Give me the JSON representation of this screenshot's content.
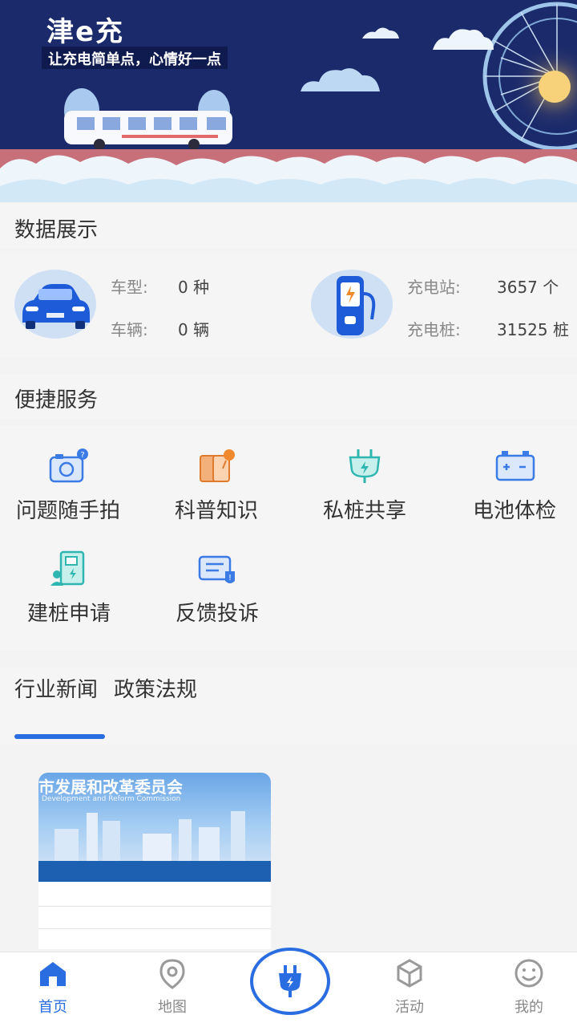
{
  "banner": {
    "brand": "津e充",
    "slogan": "让充电简单点，心情好一点"
  },
  "data_section": {
    "title": "数据展示",
    "vehicle": {
      "icon": "car-icon",
      "model_label": "车型:",
      "model_value": "0 种",
      "vehicle_label": "车辆:",
      "vehicle_value": "0 辆"
    },
    "charging": {
      "icon": "charging-pile-icon",
      "station_label": "充电站:",
      "station_value": "3657 个",
      "pile_label": "充电桩:",
      "pile_value": "31525 桩"
    }
  },
  "services_section": {
    "title": "便捷服务",
    "items": [
      {
        "label": "问题随手拍",
        "icon": "camera-icon"
      },
      {
        "label": "科普知识",
        "icon": "book-icon"
      },
      {
        "label": "私桩共享",
        "icon": "plug-share-icon"
      },
      {
        "label": "电池体检",
        "icon": "battery-icon"
      },
      {
        "label": "建桩申请",
        "icon": "pile-apply-icon"
      },
      {
        "label": "反馈投诉",
        "icon": "feedback-icon"
      }
    ]
  },
  "news_section": {
    "tabs": [
      {
        "label": "行业新闻",
        "active": true
      },
      {
        "label": "政策法规",
        "active": false
      }
    ],
    "card": {
      "title": "市发展和改革委员会",
      "subtitle": "Development and Reform Commission"
    }
  },
  "bottom_nav": {
    "items": [
      {
        "label": "首页",
        "icon": "home-icon",
        "active": true
      },
      {
        "label": "地图",
        "icon": "map-pin-icon",
        "active": false
      },
      {
        "label": "",
        "icon": "plug-icon",
        "active": false
      },
      {
        "label": "活动",
        "icon": "cube-icon",
        "active": false
      },
      {
        "label": "我的",
        "icon": "smile-icon",
        "active": false
      }
    ]
  },
  "colors": {
    "accent": "#2a6de0",
    "banner_bg": "#1b2a6b"
  }
}
